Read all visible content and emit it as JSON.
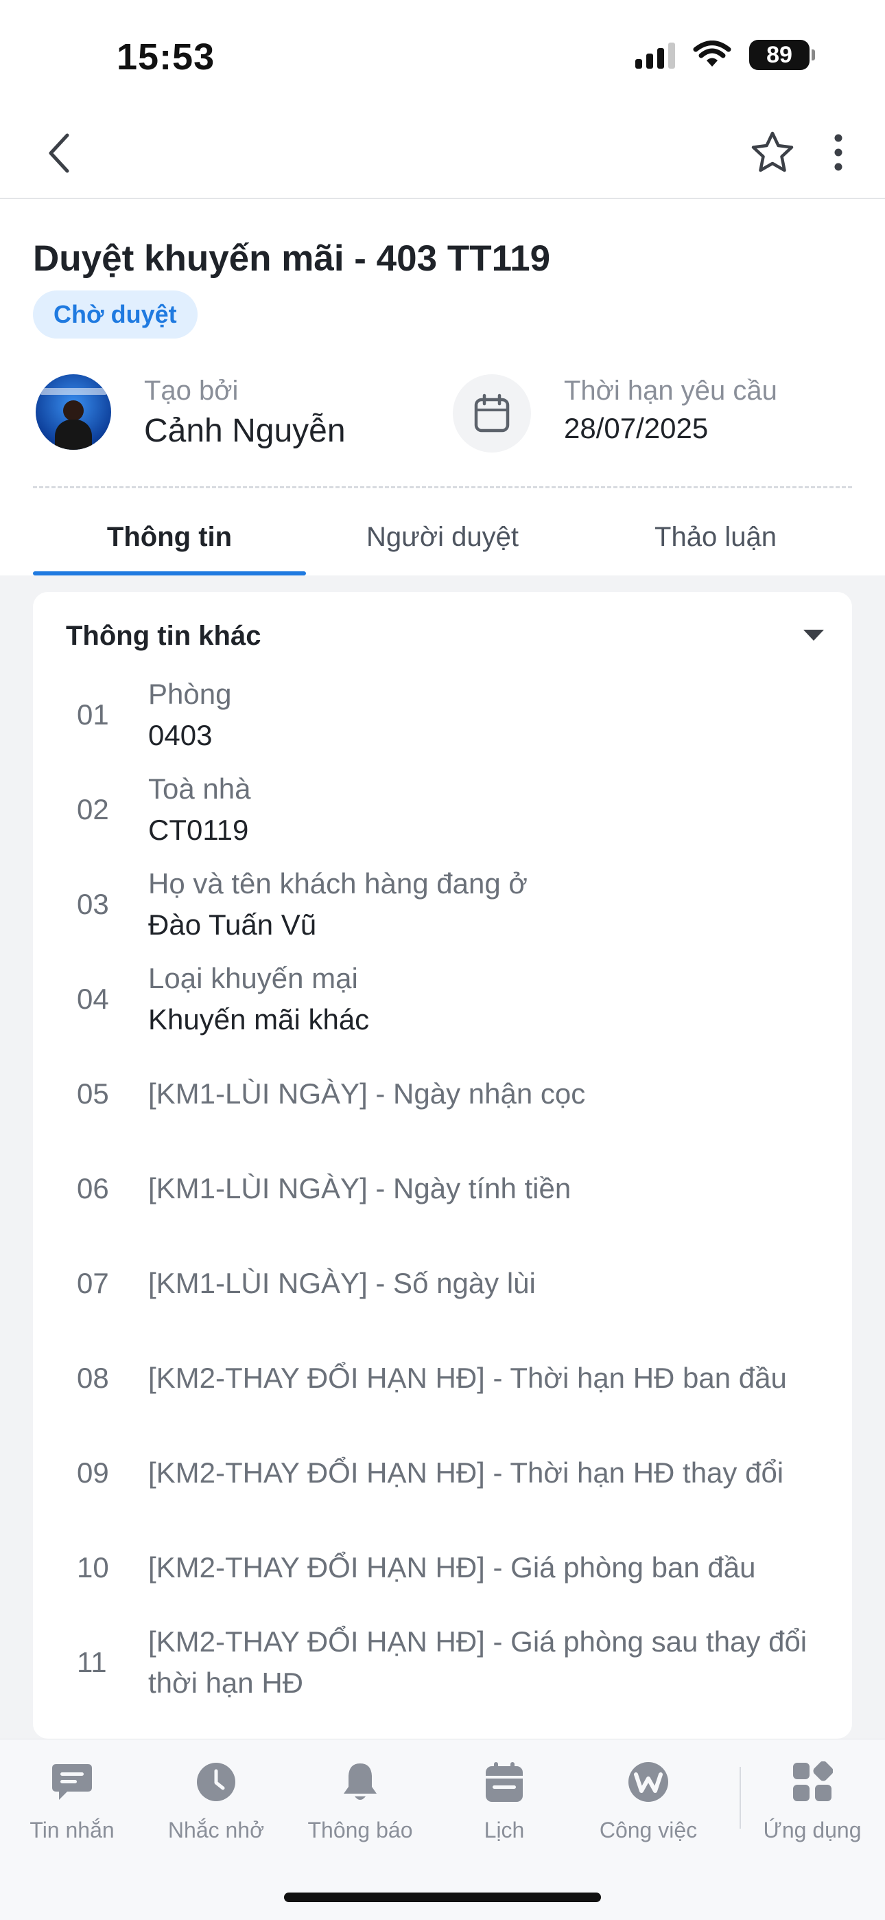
{
  "status_bar": {
    "time": "15:53",
    "battery": "89"
  },
  "header": {
    "title": "Duyệt khuyến mãi - 403 TT119",
    "status_badge": "Chờ duyệt",
    "creator_label": "Tạo bởi",
    "creator_name": "Cảnh Nguyễn",
    "deadline_label": "Thời hạn yêu cầu",
    "deadline_value": "28/07/2025"
  },
  "tabs": [
    {
      "label": "Thông tin",
      "active": true
    },
    {
      "label": "Người duyệt",
      "active": false
    },
    {
      "label": "Thảo luận",
      "active": false
    }
  ],
  "section": {
    "title": "Thông tin khác",
    "fields": [
      {
        "num": "01",
        "label": "Phòng",
        "value": "0403"
      },
      {
        "num": "02",
        "label": "Toà nhà",
        "value": "CT0119"
      },
      {
        "num": "03",
        "label": "Họ và tên khách hàng đang ở",
        "value": "Đào Tuấn Vũ"
      },
      {
        "num": "04",
        "label": "Loại khuyến mại",
        "value": "Khuyến mãi khác"
      },
      {
        "num": "05",
        "label": "[KM1-LÙI NGÀY] - Ngày nhận cọc",
        "value": ""
      },
      {
        "num": "06",
        "label": "[KM1-LÙI NGÀY] - Ngày tính tiền",
        "value": ""
      },
      {
        "num": "07",
        "label": "[KM1-LÙI NGÀY] - Số ngày lùi",
        "value": ""
      },
      {
        "num": "08",
        "label": "[KM2-THAY ĐỔI HẠN HĐ] - Thời hạn HĐ ban đầu",
        "value": ""
      },
      {
        "num": "09",
        "label": "[KM2-THAY ĐỔI HẠN HĐ] - Thời hạn HĐ thay đổi",
        "value": ""
      },
      {
        "num": "10",
        "label": "[KM2-THAY ĐỔI HẠN HĐ] - Giá phòng ban đầu",
        "value": ""
      },
      {
        "num": "11",
        "label": "[KM2-THAY ĐỔI HẠN HĐ] - Giá phòng sau thay đổi thời hạn HĐ",
        "value": ""
      }
    ]
  },
  "tab_bar": [
    {
      "label": "Tin nhắn",
      "icon": "message-icon"
    },
    {
      "label": "Nhắc nhở",
      "icon": "clock-icon"
    },
    {
      "label": "Thông báo",
      "icon": "bell-icon"
    },
    {
      "label": "Lịch",
      "icon": "calendar-icon"
    },
    {
      "label": "Công việc",
      "icon": "work-icon"
    },
    {
      "label": "Ứng dụng",
      "icon": "apps-icon"
    }
  ],
  "colors": {
    "accent": "#1f7ae0",
    "badge_bg": "#e1effe",
    "muted": "#8a8f99",
    "tab_icon": "#8a8f99"
  }
}
